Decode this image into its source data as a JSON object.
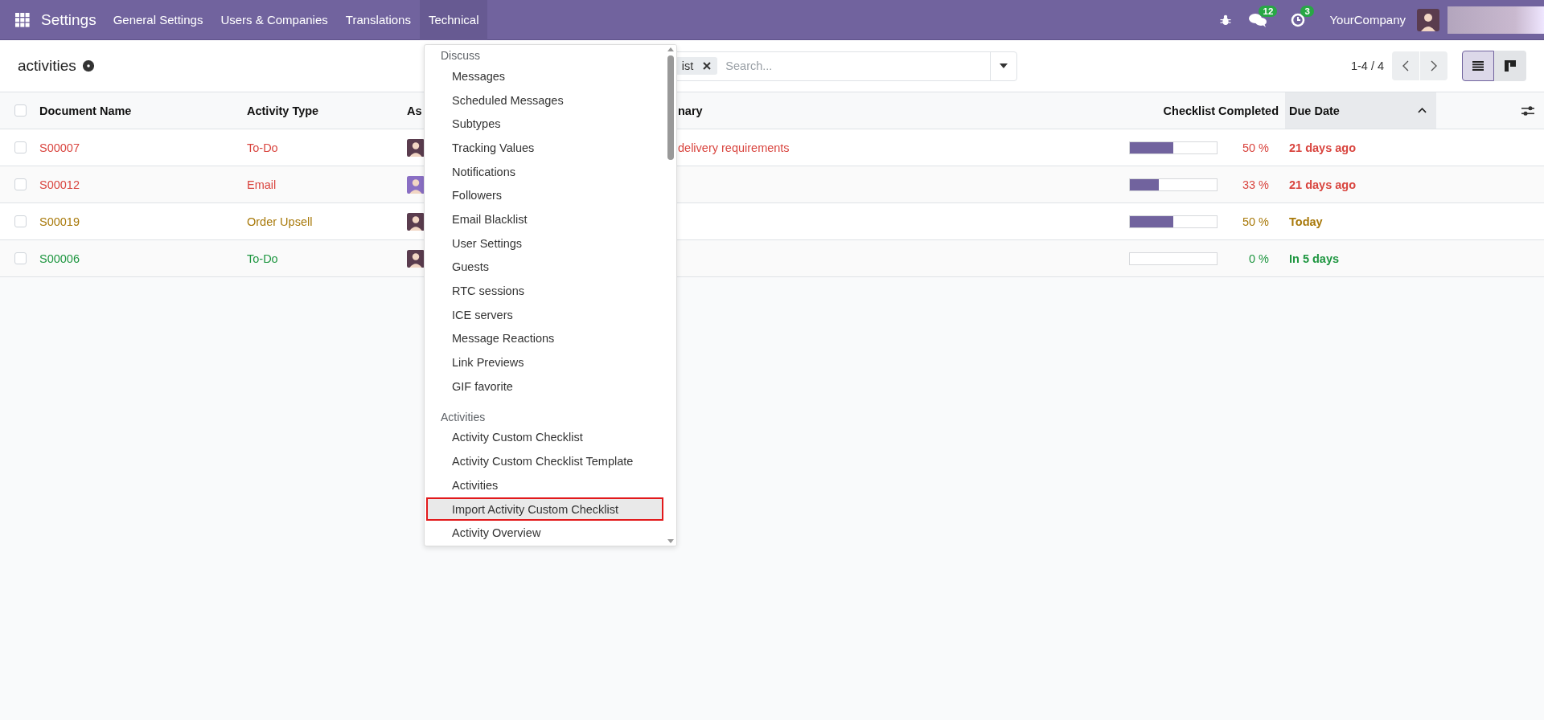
{
  "navbar": {
    "app_name": "Settings",
    "menu": [
      {
        "label": "General Settings",
        "selected": false
      },
      {
        "label": "Users & Companies",
        "selected": false
      },
      {
        "label": "Translations",
        "selected": false
      },
      {
        "label": "Technical",
        "selected": true
      }
    ],
    "messages_badge": "12",
    "activities_badge": "3",
    "company": "YourCompany"
  },
  "control_panel": {
    "title": "activities",
    "facet": "ist",
    "search": {
      "placeholder": "Search..."
    },
    "pager": "1-4 / 4",
    "views": [
      {
        "kind": "list",
        "selected": true
      },
      {
        "kind": "kanban",
        "selected": false
      }
    ]
  },
  "table": {
    "select_all_checked": false,
    "columns": [
      "Document Name",
      "Activity Type",
      "As",
      "nary",
      "Checklist Completed",
      "Due Date"
    ],
    "rows": [
      {
        "color": "#d9453f",
        "checked": false,
        "document": "S00007",
        "type": "To-Do",
        "summary": "delivery requirements",
        "level": 0.5,
        "percent": "50 %",
        "due": "21 days ago"
      },
      {
        "color": "#d9453f",
        "checked": false,
        "document": "S00012",
        "type": "Email",
        "level": 0.33,
        "percent": "33 %",
        "due": "21 days ago"
      },
      {
        "color": "#a8790a",
        "checked": false,
        "document": "S00019",
        "type": "Order Upsell",
        "level": 0.5,
        "percent": "50 %",
        "due": "Today"
      },
      {
        "color": "#1e9640",
        "checked": false,
        "document": "S00006",
        "type": "To-Do",
        "level": 0,
        "percent": "0 %",
        "due": "In 5 days"
      }
    ]
  },
  "technical_menu": {
    "sections": [
      {
        "title": "Discuss",
        "items": [
          {
            "label": "Messages",
            "selected": false
          },
          {
            "label": "Scheduled Messages",
            "selected": false
          },
          {
            "label": "Subtypes",
            "selected": false
          },
          {
            "label": "Tracking Values",
            "selected": false
          },
          {
            "label": "Notifications",
            "selected": false
          },
          {
            "label": "Followers",
            "selected": false
          },
          {
            "label": "Email Blacklist",
            "selected": false
          },
          {
            "label": "User Settings",
            "selected": false
          },
          {
            "label": "Guests",
            "selected": false
          },
          {
            "label": "RTC sessions",
            "selected": false
          },
          {
            "label": "ICE servers",
            "selected": false
          },
          {
            "label": "Message Reactions",
            "selected": false
          },
          {
            "label": "Link Previews",
            "selected": false
          },
          {
            "label": "GIF favorite",
            "selected": false
          }
        ]
      },
      {
        "title": "Activities",
        "items": [
          {
            "label": "Activity Custom Checklist",
            "selected": false
          },
          {
            "label": "Activity Custom Checklist Template",
            "selected": false
          },
          {
            "label": "Activities",
            "selected": false
          },
          {
            "label": "Import Activity Custom Checklist",
            "selected": true
          },
          {
            "label": "Activity Overview",
            "selected": false
          }
        ]
      }
    ]
  }
}
